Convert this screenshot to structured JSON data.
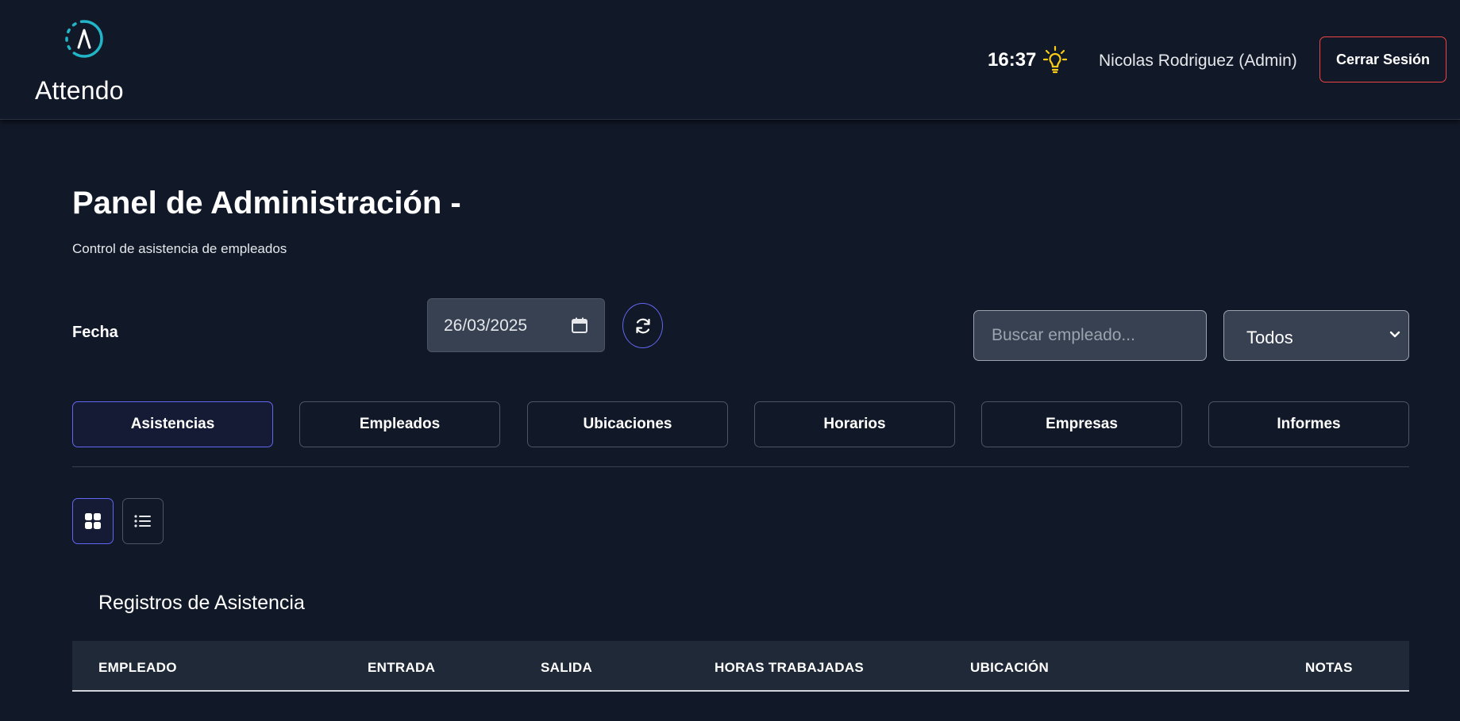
{
  "header": {
    "brand": "Attendo",
    "time": "16:37",
    "user": "Nicolas Rodriguez (Admin)",
    "logout_label": "Cerrar Sesión",
    "icons": {
      "logo": "logo-icon",
      "theme": "lightbulb-icon"
    },
    "colors": {
      "logo_accent": "#22b5c8",
      "bulb": "#facc15",
      "logout_border": "#ef4444"
    }
  },
  "main": {
    "title": "Panel de Administración -",
    "subtitle": "Control de asistencia de empleados",
    "date_label": "Fecha",
    "date_value": "26/03/2025",
    "search_placeholder": "Buscar empleado...",
    "filter_selected": "Todos",
    "tabs": [
      {
        "label": "Asistencias",
        "active": true
      },
      {
        "label": "Empleados",
        "active": false
      },
      {
        "label": "Ubicaciones",
        "active": false
      },
      {
        "label": "Horarios",
        "active": false
      },
      {
        "label": "Empresas",
        "active": false
      },
      {
        "label": "Informes",
        "active": false
      }
    ],
    "view_modes": [
      {
        "icon": "grid-view-icon",
        "active": true
      },
      {
        "icon": "list-view-icon",
        "active": false
      }
    ],
    "accent_color": "#6366f1"
  },
  "table": {
    "title": "Registros de Asistencia",
    "columns": [
      "EMPLEADO",
      "ENTRADA",
      "SALIDA",
      "HORAS TRABAJADAS",
      "UBICACIÓN",
      "NOTAS"
    ]
  }
}
